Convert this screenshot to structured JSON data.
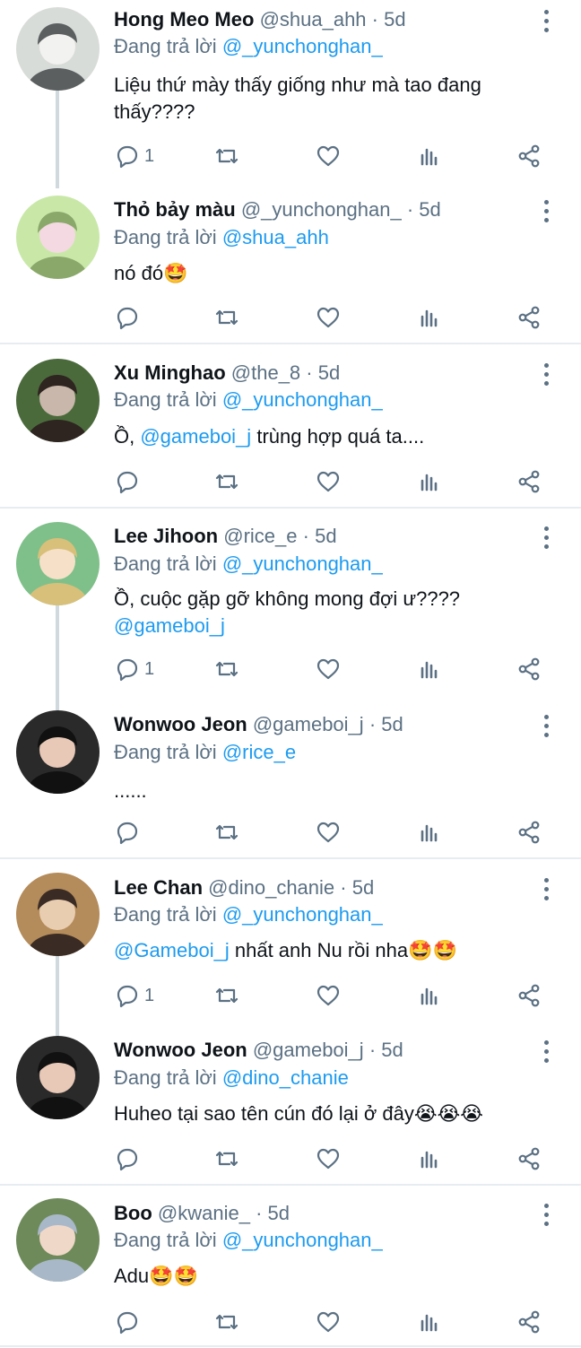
{
  "tweets": [
    {
      "name": "Hong Meo Meo",
      "handle": "@shua_ahh",
      "time": "· 5d",
      "reply_prefix": "Đang trả lời",
      "reply_to": "@_yunchonghan_",
      "body_lines": [
        "Liệu thứ mày thấy giống như mà tao đang",
        "thấy????"
      ],
      "body_mention_prefix": "",
      "reply_count": "1",
      "avatar_colors": [
        "#d8dcd8",
        "#f2f2f0",
        "#5c5f60"
      ]
    },
    {
      "name": "Thỏ bảy màu",
      "handle": "@_yunchonghan_",
      "time": "· 5d",
      "reply_prefix": "Đang trả lời",
      "reply_to": "@shua_ahh",
      "body_lines": [
        "nó đó🤩"
      ],
      "body_mention_prefix": "",
      "reply_count": "",
      "avatar_colors": [
        "#c9e8a8",
        "#f4d9e2",
        "#8ba86b"
      ]
    },
    {
      "name": "Xu Minghao",
      "handle": "@the_8",
      "time": "· 5d",
      "reply_prefix": "Đang trả lời",
      "reply_to": "@_yunchonghan_",
      "body_lines": [
        "trùng hợp quá ta...."
      ],
      "body_mention_prefix": "Ồ, ",
      "body_mention": "@gameboi_j",
      "reply_count": "",
      "avatar_colors": [
        "#4b6a3c",
        "#c8b7aa",
        "#2e2420"
      ]
    },
    {
      "name": "Lee Jihoon",
      "handle": "@rice_e",
      "time": "· 5d",
      "reply_prefix": "Đang trả lời",
      "reply_to": "@_yunchonghan_",
      "body_lines": [
        "Ồ, cuộc gặp gỡ không mong đợi ư????"
      ],
      "body_mention_line2": "@gameboi_j",
      "reply_count": "1",
      "avatar_colors": [
        "#7fc08a",
        "#f6e0c8",
        "#d8c07a"
      ]
    },
    {
      "name": "Wonwoo Jeon",
      "handle": "@gameboi_j",
      "time": "· 5d",
      "reply_prefix": "Đang trả lời",
      "reply_to": "@rice_e",
      "body_lines": [
        "......"
      ],
      "reply_count": "",
      "avatar_colors": [
        "#2a2a2a",
        "#e8c8b6",
        "#111111"
      ]
    },
    {
      "name": "Lee Chan",
      "handle": "@dino_chanie",
      "time": "· 5d",
      "reply_prefix": "Đang trả lời",
      "reply_to": "@_yunchonghan_",
      "body_lines": [
        "nhất anh Nu rồi nha🤩🤩"
      ],
      "body_mention_prefix": "",
      "body_mention": "@Gameboi_j",
      "reply_count": "1",
      "avatar_colors": [
        "#b48b5a",
        "#e9cdb0",
        "#3a2c24"
      ]
    },
    {
      "name": "Wonwoo Jeon",
      "handle": "@gameboi_j",
      "time": "· 5d",
      "reply_prefix": "Đang trả lời",
      "reply_to": "@dino_chanie",
      "body_lines": [
        "Huheo tại sao tên cún đó lại ở đây😭😭😭"
      ],
      "reply_count": "",
      "avatar_colors": [
        "#2a2a2a",
        "#e8c8b6",
        "#111111"
      ]
    },
    {
      "name": "Boo",
      "handle": "@kwanie_",
      "time": "· 5d",
      "reply_prefix": "Đang trả lời",
      "reply_to": "@_yunchonghan_",
      "body_lines": [
        "Adu🤩🤩"
      ],
      "reply_count": "",
      "avatar_colors": [
        "#6e8a5a",
        "#f0d8c8",
        "#a9b8c8"
      ]
    }
  ],
  "icons": {
    "reply": "reply-icon",
    "retweet": "retweet-icon",
    "like": "heart-icon",
    "stats": "stats-icon",
    "share": "share-icon",
    "more": "more-icon"
  },
  "colors": {
    "mention": "#1d9bf0",
    "meta": "#5b7083",
    "divider": "#e6ecf0",
    "thread": "#cfd9de"
  }
}
